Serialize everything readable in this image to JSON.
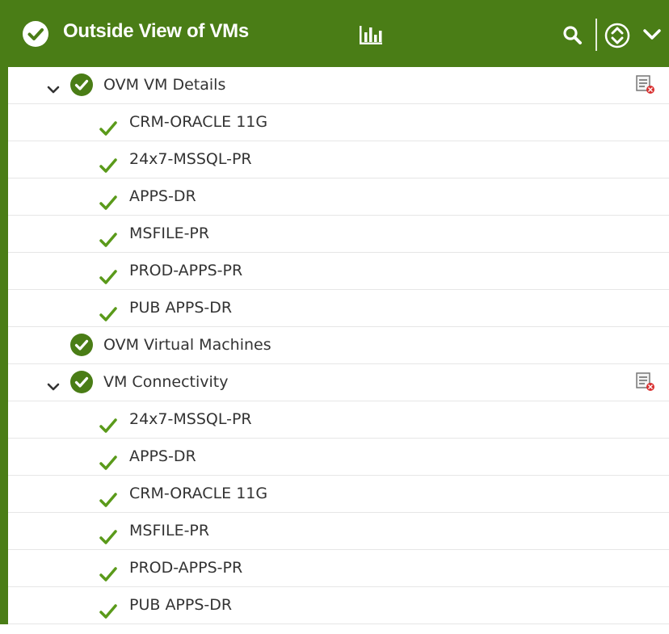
{
  "header": {
    "title": "Outside View of VMs",
    "status_icon": "check-circle-icon",
    "icons": [
      "chart-icon",
      "search-icon",
      "sort-icon",
      "chevron-down-icon"
    ],
    "background": "#4a7d16"
  },
  "tree": {
    "groups": [
      {
        "label": "OVM VM Details",
        "expanded": true,
        "items": [
          "CRM-ORACLE 11G",
          "24x7-MSSQL-PR",
          "APPS-DR",
          "MSFILE-PR",
          "PROD-APPS-PR",
          "PUB APPS-DR"
        ]
      },
      {
        "label": "OVM Virtual Machines",
        "expanded": false,
        "items": []
      },
      {
        "label": "VM Connectivity",
        "expanded": true,
        "items": [
          "24x7-MSSQL-PR",
          "APPS-DR",
          "CRM-ORACLE 11G",
          "MSFILE-PR",
          "PROD-APPS-PR",
          "PUB APPS-DR"
        ]
      }
    ]
  },
  "colors": {
    "ok_green": "#4a7d16",
    "tick_green": "#5a9a1a"
  }
}
